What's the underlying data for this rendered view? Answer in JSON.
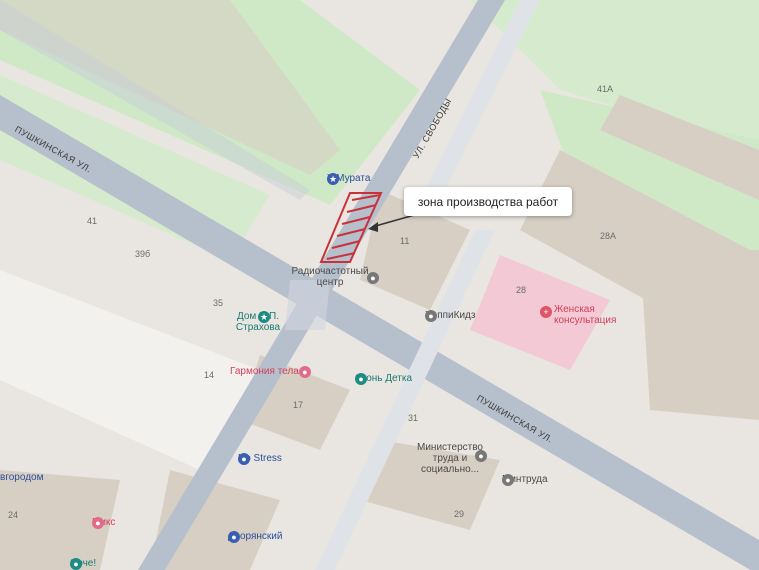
{
  "map": {
    "colors": {
      "background": "#e9e6e1",
      "park": "#cfe8c6",
      "road": "#b6bfcc",
      "building": "#d7cfc4",
      "hospital": "#f2c9d4",
      "work_zone_stroke": "#c8323a"
    },
    "streets": {
      "pushkinskaya_left": "Пушкинская ул.",
      "pushkinskaya_right": "Пушкинская ул.",
      "svobody": "ул. Свободы",
      "novgorod_fragment": "вгородом"
    },
    "callout": {
      "text": "зона производства работ"
    },
    "house_numbers": {
      "n41": "41",
      "n39b": "39б",
      "n35": "35",
      "n14": "14",
      "n11": "11",
      "n28": "28",
      "n28a": "28А",
      "n41a": "41А",
      "n17": "17",
      "n31": "31",
      "n29": "29",
      "n24": "24"
    },
    "pois": {
      "u_murata": {
        "label": "У Мурата",
        "icon": "restaurant-icon"
      },
      "radio_center": {
        "label": "Радиочастотный центр",
        "icon": "office-icon"
      },
      "happykids": {
        "label": "ХеппиКидз",
        "icon": "kids-icon"
      },
      "women_clinic": {
        "label": "Женская консультация",
        "icon": "medical-icon"
      },
      "strakhov_house": {
        "label": "Дом Н.П. Страхова",
        "icon": "landmark-icon"
      },
      "garmonia": {
        "label": "Гармония тела",
        "icon": "beauty-icon"
      },
      "ogon_detka": {
        "label": "Огонь Детка",
        "icon": "shop-icon"
      },
      "ministry": {
        "label": "Министерство труда и социально...",
        "icon": "government-icon"
      },
      "mintruda": {
        "label": "Минтруда",
        "icon": "government-icon"
      },
      "no_stress": {
        "label": "No Stress",
        "icon": "bar-icon"
      },
      "miks": {
        "label": "Микс",
        "icon": "beauty-icon"
      },
      "dvoryansky": {
        "label": "Дворянский",
        "icon": "cafe-icon"
      },
      "yarche": {
        "label": "Ярче!",
        "icon": "shop-icon"
      }
    }
  }
}
